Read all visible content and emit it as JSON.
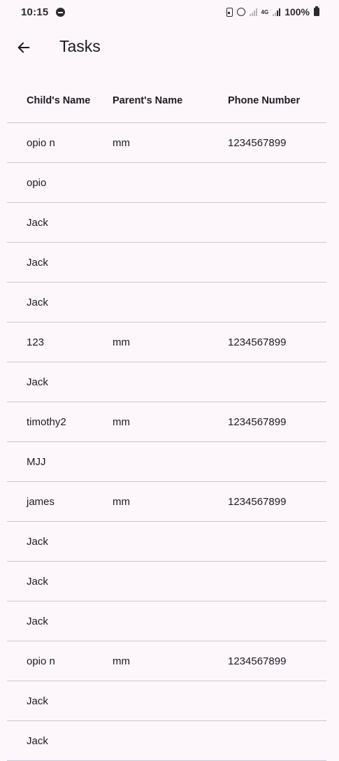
{
  "status_bar": {
    "time": "10:15",
    "network_type": "4G",
    "battery": "100%"
  },
  "app_bar": {
    "title": "Tasks",
    "back_icon": "arrow-back-icon"
  },
  "table": {
    "columns": [
      "Child's Name",
      "Parent's Name",
      "Phone Number"
    ],
    "rows": [
      {
        "child": "opio n",
        "parent": "mm",
        "phone": "1234567899"
      },
      {
        "child": "opio",
        "parent": "",
        "phone": ""
      },
      {
        "child": "Jack",
        "parent": "",
        "phone": ""
      },
      {
        "child": "Jack",
        "parent": "",
        "phone": ""
      },
      {
        "child": "Jack",
        "parent": "",
        "phone": ""
      },
      {
        "child": "123",
        "parent": "mm",
        "phone": "1234567899"
      },
      {
        "child": "Jack",
        "parent": "",
        "phone": ""
      },
      {
        "child": "timothy2",
        "parent": "mm",
        "phone": "1234567899"
      },
      {
        "child": "MJJ",
        "parent": "",
        "phone": ""
      },
      {
        "child": "james",
        "parent": "mm",
        "phone": "1234567899"
      },
      {
        "child": "Jack",
        "parent": "",
        "phone": ""
      },
      {
        "child": "Jack",
        "parent": "",
        "phone": ""
      },
      {
        "child": "Jack",
        "parent": "",
        "phone": ""
      },
      {
        "child": "opio n",
        "parent": "mm",
        "phone": "1234567899"
      },
      {
        "child": "Jack",
        "parent": "",
        "phone": ""
      },
      {
        "child": "Jack",
        "parent": "",
        "phone": ""
      }
    ]
  },
  "colors": {
    "background": "#fdf7fc",
    "text": "#1d1b20",
    "divider": "#cac4cf"
  }
}
